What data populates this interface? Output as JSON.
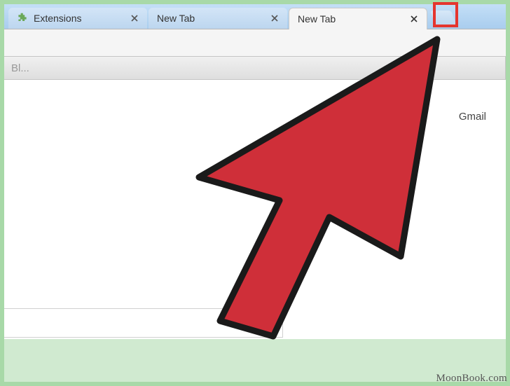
{
  "tabs": [
    {
      "label": "Extensions",
      "active": false
    },
    {
      "label": "New Tab",
      "active": false
    },
    {
      "label": "New Tab",
      "active": true
    }
  ],
  "url_truncated": "Bl...",
  "links": {
    "gmail": "Gmail"
  },
  "watermark": "MoonBook.com",
  "highlight_target": "close-tab-button"
}
